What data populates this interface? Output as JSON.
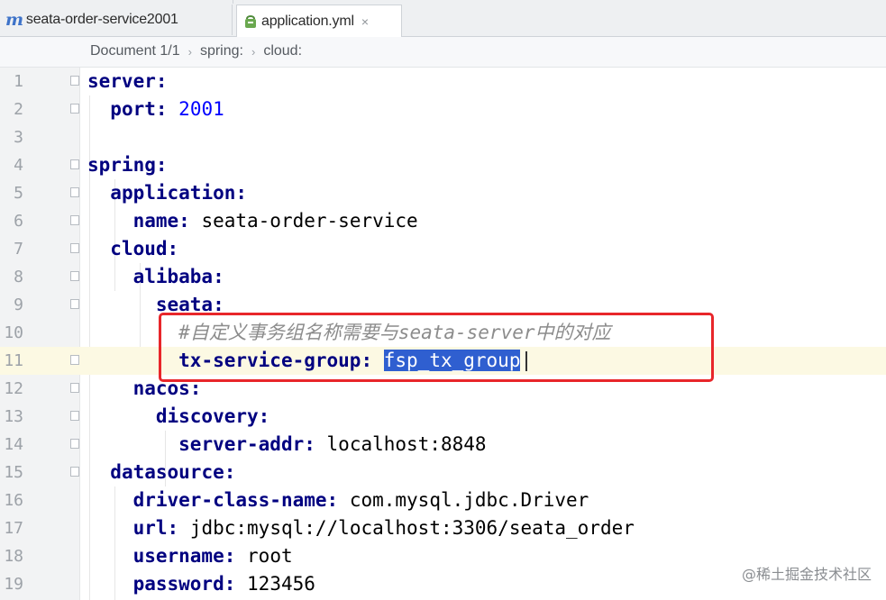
{
  "tabs": [
    {
      "label": "seata-order-service2001",
      "icon": "maven-m-icon"
    },
    {
      "label": "application.yml",
      "icon": "yaml-file-icon",
      "close": "×"
    }
  ],
  "breadcrumb": [
    "Document 1/1",
    "spring:",
    "cloud:"
  ],
  "editor": {
    "lines": [
      {
        "num": "1"
      },
      {
        "num": "2"
      },
      {
        "num": "3"
      },
      {
        "num": "4"
      },
      {
        "num": "5"
      },
      {
        "num": "6"
      },
      {
        "num": "7"
      },
      {
        "num": "8"
      },
      {
        "num": "9"
      },
      {
        "num": "10"
      },
      {
        "num": "11"
      },
      {
        "num": "12"
      },
      {
        "num": "13"
      },
      {
        "num": "14"
      },
      {
        "num": "15"
      },
      {
        "num": "16"
      },
      {
        "num": "17"
      },
      {
        "num": "18"
      },
      {
        "num": "19"
      }
    ],
    "code": {
      "l1_key": "server:",
      "l2_key": "port:",
      "l2_val": "2001",
      "l4_key": "spring:",
      "l5_key": "application:",
      "l6_key": "name:",
      "l6_val": "seata-order-service",
      "l7_key": "cloud:",
      "l8_key": "alibaba:",
      "l9_key": "seata:",
      "l10_comment": "#自定义事务组名称需要与seata-server中的对应",
      "l11_key": "tx-service-group:",
      "l11_val": "fsp_tx_group",
      "l12_key": "nacos:",
      "l13_key": "discovery:",
      "l14_key": "server-addr:",
      "l14_val": "localhost:8848",
      "l15_key": "datasource:",
      "l16_key": "driver-class-name:",
      "l16_val": "com.mysql.jdbc.Driver",
      "l17_key": "url:",
      "l17_val": "jdbc:mysql://localhost:3306/seata_order",
      "l18_key": "username:",
      "l18_val": "root",
      "l19_key": "password:",
      "l19_val": "123456"
    },
    "current_line": 11,
    "colors": {
      "key": "#000080",
      "number": "#0000ff",
      "comment": "#8c8c8c",
      "selection": "#2f5fd0",
      "annotation_box": "#e8262a"
    }
  },
  "watermark": "@稀土掘金技术社区"
}
